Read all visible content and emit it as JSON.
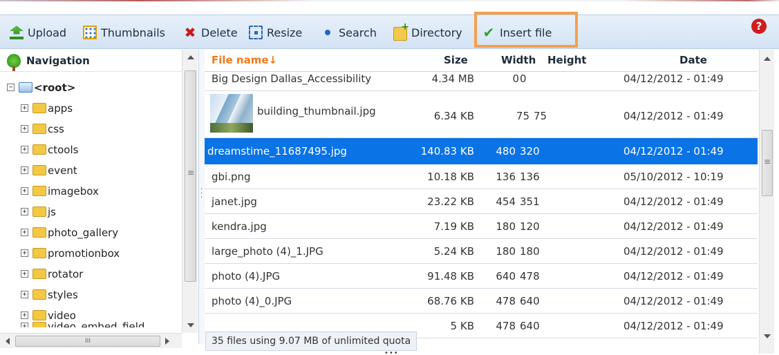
{
  "toolbar": {
    "items": [
      {
        "label": "Upload",
        "icon": "upload-icon"
      },
      {
        "label": "Thumbnails",
        "icon": "thumbnails-icon"
      },
      {
        "label": "Delete",
        "icon": "delete-icon"
      },
      {
        "label": "Resize",
        "icon": "resize-icon"
      },
      {
        "label": "Search",
        "icon": "search-icon"
      },
      {
        "label": "Directory",
        "icon": "new-folder-icon"
      },
      {
        "label": "Insert file",
        "icon": "check-icon"
      }
    ],
    "help_icon": "?",
    "highlight_color": "#f5a04a"
  },
  "navigation": {
    "title": "Navigation",
    "root": {
      "label": "<root>",
      "toggle": "−"
    },
    "folders": [
      {
        "label": "apps",
        "toggle": "+"
      },
      {
        "label": "css",
        "toggle": "+"
      },
      {
        "label": "ctools",
        "toggle": "+"
      },
      {
        "label": "event",
        "toggle": "+"
      },
      {
        "label": "imagebox",
        "toggle": "+"
      },
      {
        "label": "js",
        "toggle": "+"
      },
      {
        "label": "photo_gallery",
        "toggle": "+"
      },
      {
        "label": "promotionbox",
        "toggle": "+"
      },
      {
        "label": "rotator",
        "toggle": "+"
      },
      {
        "label": "styles",
        "toggle": "+"
      },
      {
        "label": "video",
        "toggle": "+"
      },
      {
        "label": "video_embed_field",
        "toggle": "+"
      }
    ],
    "hscroll_grip": "III"
  },
  "grid": {
    "headers": {
      "name": "File name↓",
      "size": "Size",
      "width": "Width",
      "height": "Height",
      "date": "Date"
    },
    "selected_color": "#0a73e6",
    "sort_color": "#f07a1a",
    "rows": [
      {
        "name": "Big Design Dallas_Accessibility",
        "size": "4.34 MB",
        "width": "0",
        "height": "0",
        "date": "04/12/2012 - 01:49"
      },
      {
        "name": "building_thumbnail.jpg",
        "size": "6.34 KB",
        "width": "75",
        "height": "75",
        "date": "04/12/2012 - 01:49"
      },
      {
        "name": "dreamstime_11687495.jpg",
        "size": "140.83 KB",
        "width": "480",
        "height": "320",
        "date": "04/12/2012 - 01:49"
      },
      {
        "name": "gbi.png",
        "size": "10.18 KB",
        "width": "136",
        "height": "136",
        "date": "05/10/2012 - 10:19"
      },
      {
        "name": "janet.jpg",
        "size": "23.22 KB",
        "width": "454",
        "height": "351",
        "date": "04/12/2012 - 01:49"
      },
      {
        "name": "kendra.jpg",
        "size": "7.19 KB",
        "width": "180",
        "height": "120",
        "date": "04/12/2012 - 01:49"
      },
      {
        "name": "large_photo (4)_1.JPG",
        "size": "5.24 KB",
        "width": "180",
        "height": "180",
        "date": "04/12/2012 - 01:49"
      },
      {
        "name": "photo (4).JPG",
        "size": "91.48 KB",
        "width": "640",
        "height": "478",
        "date": "04/12/2012 - 01:49"
      },
      {
        "name": "photo (4)_0.JPG",
        "size": "68.76 KB",
        "width": "478",
        "height": "640",
        "date": "04/12/2012 - 01:49"
      },
      {
        "name": "",
        "size": "5 KB",
        "width": "478",
        "height": "640",
        "date": "04/12/2012 - 01:49"
      }
    ]
  },
  "status": {
    "text": "35 files using 9.07 MB of unlimited quota"
  }
}
